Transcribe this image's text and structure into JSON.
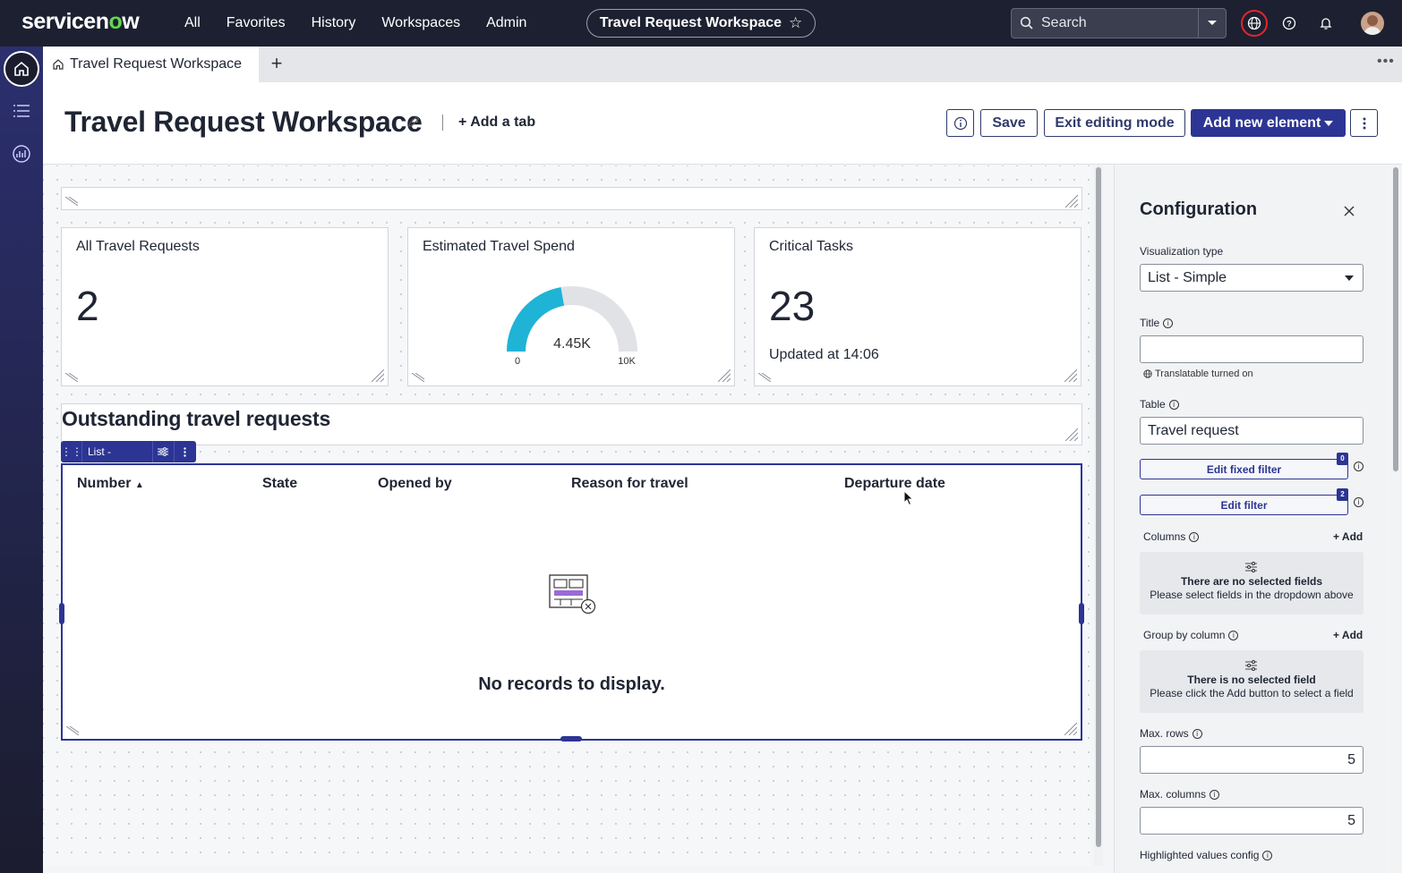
{
  "topnav": {
    "logo": "servicenow",
    "links": [
      "All",
      "Favorites",
      "History",
      "Workspaces",
      "Admin"
    ],
    "workspace_pill": "Travel Request Workspace",
    "search_placeholder": "Search"
  },
  "tabs": {
    "active_tab": "Travel Request Workspace"
  },
  "header": {
    "title": "Travel Request Workspace",
    "add_tab": "Add a tab",
    "save": "Save",
    "exit_editing": "Exit editing mode",
    "add_element": "Add new element"
  },
  "cards": [
    {
      "title": "All Travel Requests",
      "value": "2"
    },
    {
      "title": "Estimated Travel Spend",
      "gauge_value": "4.45K",
      "gauge_min": "0",
      "gauge_max": "10K",
      "gauge_fraction": 0.445
    },
    {
      "title": "Critical Tasks",
      "value": "23",
      "sub": "Updated at 14:06"
    }
  ],
  "list": {
    "heading": "Outstanding travel requests",
    "toolbar_label": "List - Simple",
    "columns": [
      "Number",
      "State",
      "Opened by",
      "Reason for travel",
      "Departure date"
    ],
    "empty": "No records to display."
  },
  "config": {
    "title": "Configuration",
    "viz_label": "Visualization type",
    "viz_value": "List - Simple",
    "title_label": "Title",
    "title_value": "",
    "translatable": "Translatable turned on",
    "table_label": "Table",
    "table_value": "Travel request",
    "edit_fixed_filter": "Edit fixed filter",
    "fixed_filter_count": "0",
    "edit_filter": "Edit filter",
    "filter_count": "2",
    "columns_label": "Columns",
    "add": "Add",
    "columns_empty_t1": "There are no selected fields",
    "columns_empty_t2": "Please select fields in the dropdown above",
    "group_label": "Group by column",
    "group_empty_t1": "There is no selected field",
    "group_empty_t2": "Please click the Add button to select a field",
    "max_rows_label": "Max. rows",
    "max_rows": "5",
    "max_cols_label": "Max. columns",
    "max_cols": "5",
    "highlight_label": "Highlighted values config"
  },
  "colors": {
    "nav_bg": "#1d2030",
    "accent": "#2c3593",
    "gauge_fill": "#1fb3d6",
    "logo_o": "#62d84e"
  }
}
